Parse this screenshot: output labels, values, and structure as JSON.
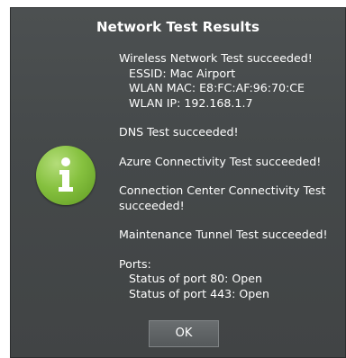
{
  "dialog": {
    "title": "Network Test Results",
    "icon": "info-icon",
    "ok_label": "OK"
  },
  "results": {
    "wireless": "Wireless Network Test succeeded!",
    "essid": "ESSID: Mac Airport",
    "wlan_mac": "WLAN MAC: E8:FC:AF:96:70:CE",
    "wlan_ip": "WLAN IP: 192.168.1.7",
    "dns": "DNS Test succeeded!",
    "azure": "Azure Connectivity Test succeeded!",
    "connection_center": "Connection Center Connectivity Test succeeded!",
    "maintenance": "Maintenance Tunnel Test succeeded!",
    "ports_header": "Ports:",
    "port_80": "Status of port 80: Open",
    "port_443": "Status of port 443: Open"
  },
  "colors": {
    "dialog_bg": "#45494a",
    "icon_green": "#86c13f",
    "text": "#ffffff"
  }
}
